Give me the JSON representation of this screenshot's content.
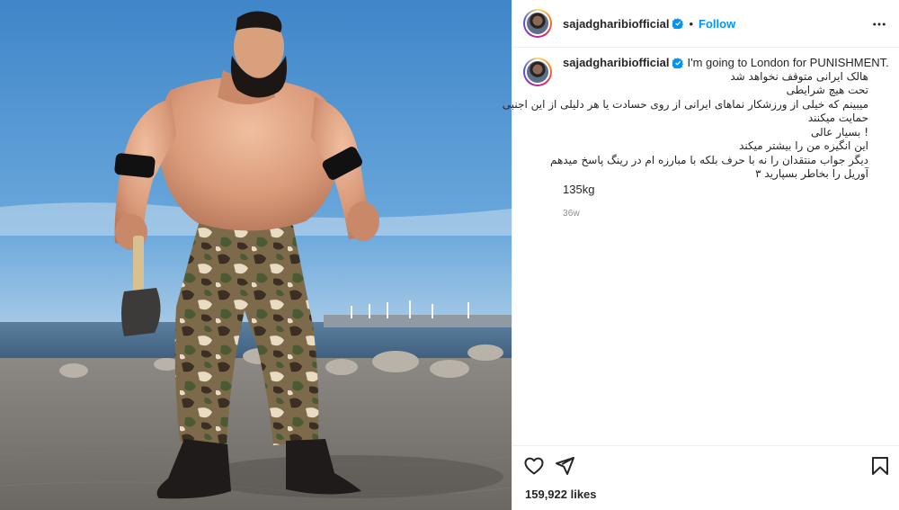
{
  "colors": {
    "accent": "#0095f6",
    "text": "#262626",
    "muted": "#8e8e8e",
    "divider": "#efefef"
  },
  "post": {
    "header": {
      "username": "sajadgharibiofficial",
      "separator": "•",
      "follow_label": "Follow"
    },
    "caption": {
      "username": "sajadgharibiofficial",
      "text_en": "I'm going to London for PUNISHMENT.",
      "lines_fa": [
        "هالک ایرانی متوقف نخواهد شد",
        "تحت هیچ شرایطی",
        "میبینم که خیلی از ورزشکار نماهای ایرانی از روی حسادت یا هر دلیلی از این اجنبی",
        "حمایت میکنند",
        "! بسیار عالی",
        "این انگیزه من را بیشتر میکند",
        "دیگر جواب منتقدان را نه با حرف بلکه با مبارزه ام در رینگ پاسخ میدهم",
        "آوریل را بخاطر بسپارید ۳"
      ],
      "weight": "135kg",
      "age": "36w"
    },
    "actions": {
      "like_icon": "heart-icon",
      "share_icon": "paper-plane-icon",
      "save_icon": "bookmark-icon",
      "likes": "159,922 likes"
    }
  }
}
